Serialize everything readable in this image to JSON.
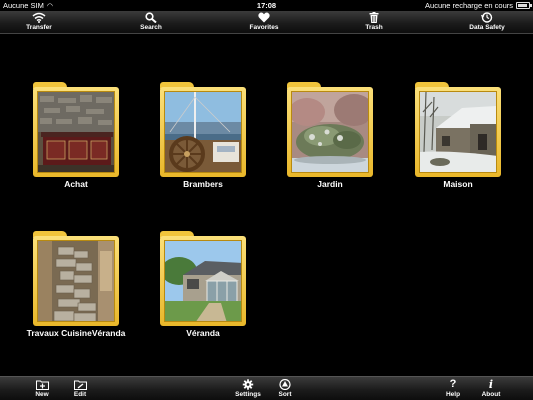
{
  "status_bar": {
    "carrier": "Aucune SIM",
    "time": "17:08",
    "charging": "Aucune recharge en cours",
    "battery_level": 0.9
  },
  "top_toolbar": {
    "transfer": "Transfer",
    "search": "Search",
    "favorites": "Favorites",
    "trash": "Trash",
    "data_safety": "Data Safety"
  },
  "folders": [
    {
      "label": "Achat",
      "thumbnail": "kitchen-photo"
    },
    {
      "label": "Brambers",
      "thumbnail": "boat-photo"
    },
    {
      "label": "Jardin",
      "thumbnail": "garden-photo"
    },
    {
      "label": "Maison",
      "thumbnail": "snowy-house-photo"
    },
    {
      "label": "Travaux CuisineVéranda",
      "thumbnail": "stone-wall-photo"
    },
    {
      "label": "Véranda",
      "thumbnail": "veranda-photo"
    }
  ],
  "bottom_toolbar": {
    "new": "New",
    "edit": "Edit",
    "settings": "Settings",
    "sort": "Sort",
    "help": "Help",
    "about": "About"
  },
  "colors": {
    "background": "#000000",
    "folder": "#f0c43c",
    "toolbar": "#2a2a2a"
  }
}
